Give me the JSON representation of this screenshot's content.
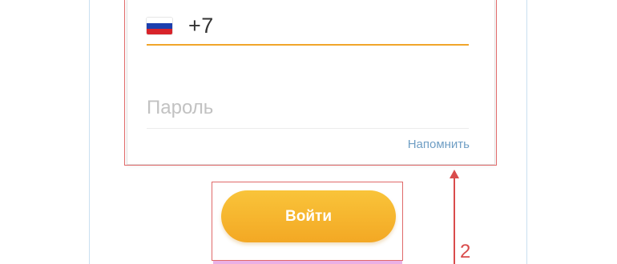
{
  "login_form": {
    "phone": {
      "country_flag": "russia-flag-icon",
      "value": "+7"
    },
    "password": {
      "placeholder": "Пароль",
      "value": ""
    },
    "remind_link": "Напомнить",
    "submit_label": "Войти"
  },
  "annotations": {
    "step_number": "2"
  },
  "colors": {
    "accent_orange": "#f0a52a",
    "button_top": "#f9c43a",
    "button_bottom": "#f3a824",
    "link_blue": "#6f9ec4",
    "annotation_red": "#d94c4c",
    "flag_white": "#ffffff",
    "flag_blue": "#1c3fae",
    "flag_red": "#d8232a"
  }
}
